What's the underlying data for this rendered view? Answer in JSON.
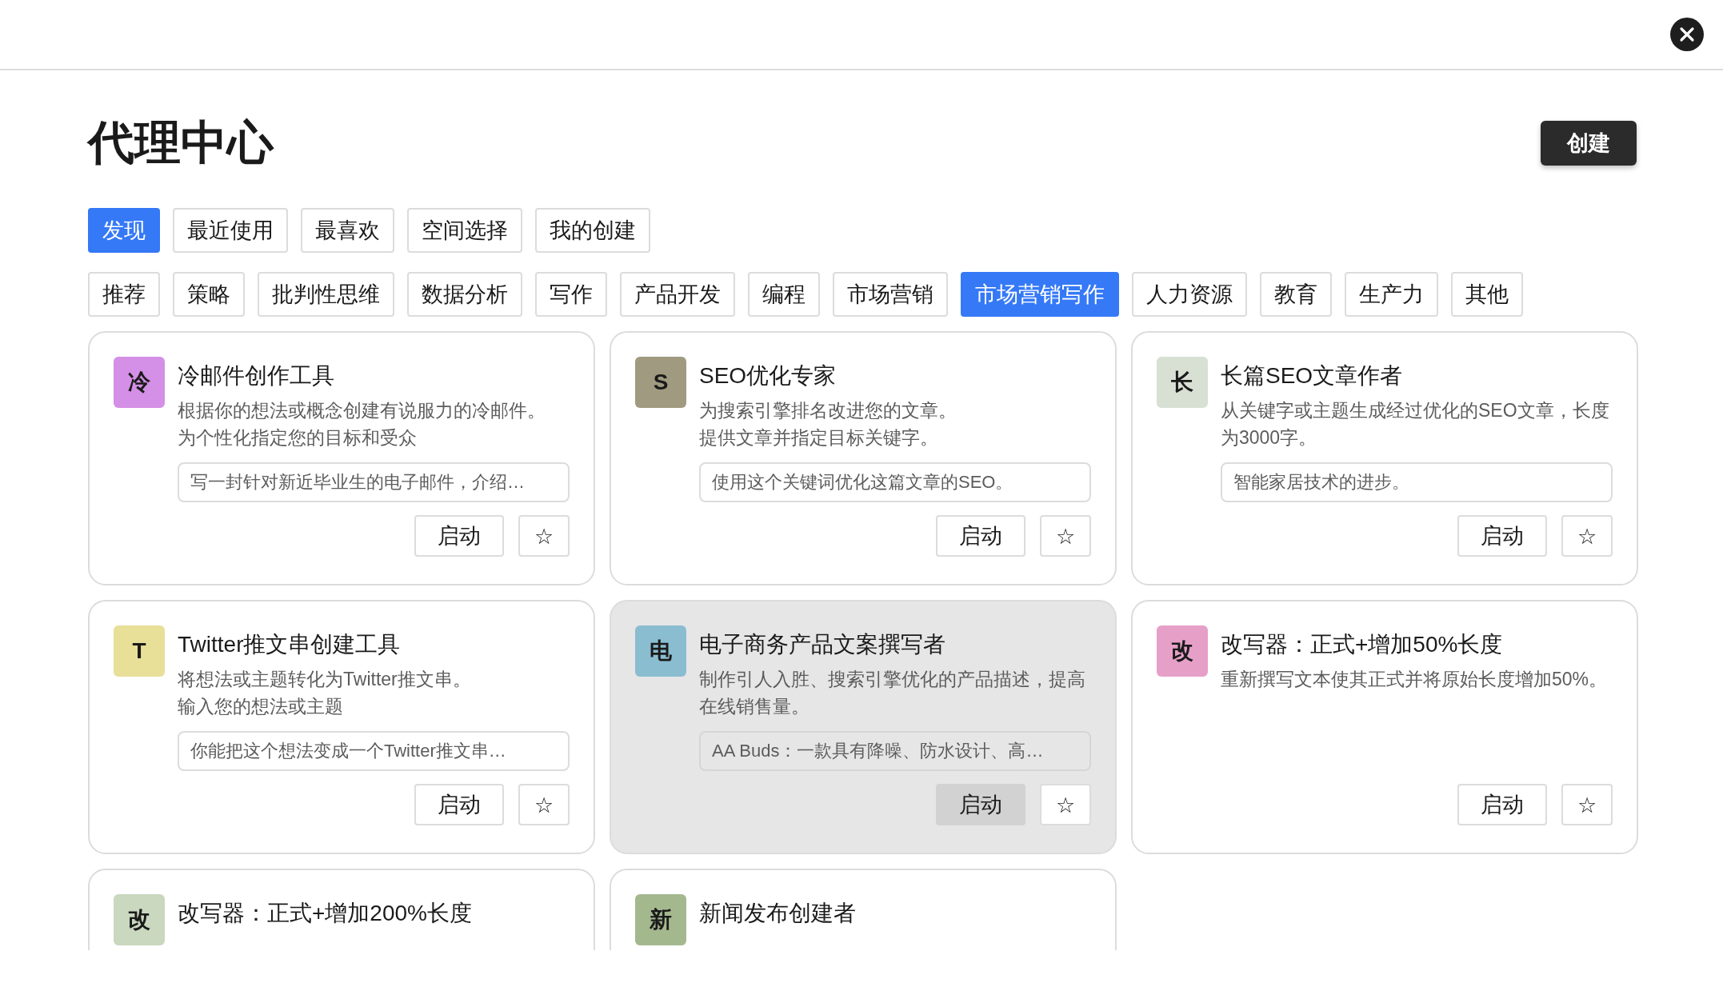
{
  "page": {
    "title": "代理中心",
    "create_button": "创建"
  },
  "nav_tabs": [
    {
      "label": "发现",
      "selected": true
    },
    {
      "label": "最近使用",
      "selected": false
    },
    {
      "label": "最喜欢",
      "selected": false
    },
    {
      "label": "空间选择",
      "selected": false
    },
    {
      "label": "我的创建",
      "selected": false
    }
  ],
  "categories": [
    {
      "label": "推荐",
      "selected": false
    },
    {
      "label": "策略",
      "selected": false
    },
    {
      "label": "批判性思维",
      "selected": false
    },
    {
      "label": "数据分析",
      "selected": false
    },
    {
      "label": "写作",
      "selected": false
    },
    {
      "label": "产品开发",
      "selected": false
    },
    {
      "label": "编程",
      "selected": false
    },
    {
      "label": "市场营销",
      "selected": false
    },
    {
      "label": "市场营销写作",
      "selected": true
    },
    {
      "label": "人力资源",
      "selected": false
    },
    {
      "label": "教育",
      "selected": false
    },
    {
      "label": "生产力",
      "selected": false
    },
    {
      "label": "其他",
      "selected": false
    }
  ],
  "agents": [
    {
      "icon_text": "冷",
      "color": "#d48fe6",
      "title": "冷邮件创作工具",
      "description": [
        "根据你的想法或概念创建有说服力的冷邮件。",
        "为个性化指定您的目标和受众"
      ],
      "placeholder": "写一封针对新近毕业生的电子邮件，介绍…",
      "start_button": "启动",
      "star": "☆",
      "hovered": false
    },
    {
      "icon_text": "S",
      "color": "#a09a80",
      "title": "SEO优化专家",
      "description": [
        "为搜索引擎排名改进您的文章。",
        "提供文章并指定目标关键字。"
      ],
      "placeholder": "使用这个关键词优化这篇文章的SEO。",
      "start_button": "启动",
      "star": "☆",
      "hovered": false
    },
    {
      "icon_text": "长",
      "color": "#d8e0d4",
      "title": "长篇SEO文章作者",
      "description": [
        "从关键字或主题生成经过优化的SEO文章，长度为3000字。"
      ],
      "placeholder": "智能家居技术的进步。",
      "start_button": "启动",
      "star": "☆",
      "hovered": false
    },
    {
      "icon_text": "T",
      "color": "#e8df98",
      "title": "Twitter推文串创建工具",
      "description": [
        "将想法或主题转化为Twitter推文串。",
        "输入您的想法或主题"
      ],
      "placeholder": "你能把这个想法变成一个Twitter推文串…",
      "start_button": "启动",
      "star": "☆",
      "hovered": false
    },
    {
      "icon_text": "电",
      "color": "#8bbdd1",
      "title": "电子商务产品文案撰写者",
      "description": [
        "制作引人入胜、搜索引擎优化的产品描述，提高在线销售量。"
      ],
      "placeholder": "AA Buds：一款具有降噪、防水设计、高…",
      "start_button": "启动",
      "star": "☆",
      "hovered": true
    },
    {
      "icon_text": "改",
      "color": "#e6a0c8",
      "title": "改写器：正式+增加50%长度",
      "description": [
        "重新撰写文本使其正式并将原始长度增加50%。"
      ],
      "start_button": "启动",
      "star": "☆",
      "hovered": false
    },
    {
      "icon_text": "改",
      "color": "#c9d8bf",
      "title": "改写器：正式+增加200%长度",
      "hovered": false
    },
    {
      "icon_text": "新",
      "color": "#a4b88e",
      "title": "新闻发布创建者",
      "hovered": false
    }
  ]
}
